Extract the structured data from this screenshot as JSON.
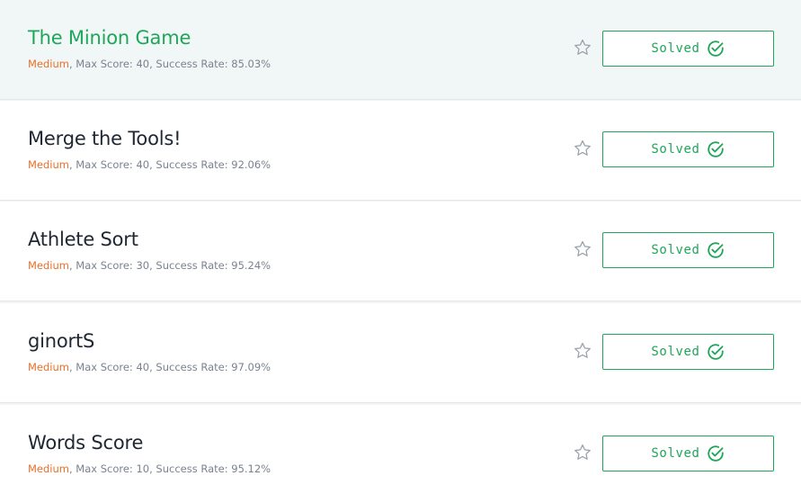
{
  "colors": {
    "accent_green": "#1fa65a",
    "difficulty_orange": "#e8702a",
    "meta_gray": "#7a8290",
    "hover_row_bg": "#f1f6f6"
  },
  "challenges": [
    {
      "title": "The Minion Game",
      "difficulty": "Medium",
      "details": ", Max Score: 40, Success Rate: 85.03%",
      "status_label": "Solved",
      "bookmark_icon": "star-outline-icon",
      "status_icon": "check-circle-icon",
      "highlighted": true
    },
    {
      "title": "Merge the Tools!",
      "difficulty": "Medium",
      "details": ", Max Score: 40, Success Rate: 92.06%",
      "status_label": "Solved",
      "bookmark_icon": "star-outline-icon",
      "status_icon": "check-circle-icon",
      "highlighted": false
    },
    {
      "title": "Athlete Sort",
      "difficulty": "Medium",
      "details": ", Max Score: 30, Success Rate: 95.24%",
      "status_label": "Solved",
      "bookmark_icon": "star-outline-icon",
      "status_icon": "check-circle-icon",
      "highlighted": false
    },
    {
      "title": "ginortS",
      "difficulty": "Medium",
      "details": ", Max Score: 40, Success Rate: 97.09%",
      "status_label": "Solved",
      "bookmark_icon": "star-outline-icon",
      "status_icon": "check-circle-icon",
      "highlighted": false
    },
    {
      "title": "Words Score",
      "difficulty": "Medium",
      "details": ", Max Score: 10, Success Rate: 95.12%",
      "status_label": "Solved",
      "bookmark_icon": "star-outline-icon",
      "status_icon": "check-circle-icon",
      "highlighted": false
    }
  ]
}
